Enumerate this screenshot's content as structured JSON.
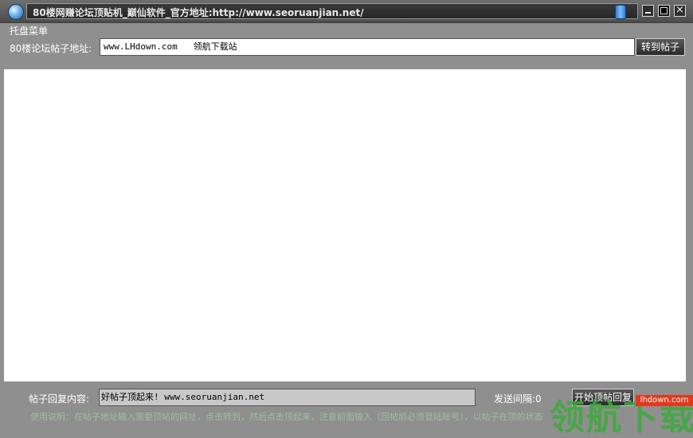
{
  "window": {
    "title": "80楼网赚论坛顶贴机_巅仙软件_官方地址:http://www.seoruanjian.net/",
    "close_glyph": "×"
  },
  "menu": {
    "tray_menu_label": "托盘菜单"
  },
  "url_section": {
    "label": "80楼论坛帖子地址:",
    "value": "www.LHdown.com   领航下载站",
    "goto_button_label": "转到帖子"
  },
  "reply_section": {
    "label": "帖子回复内容:",
    "value": "好帖子顶起来! www.seoruanjian.net",
    "interval_label": "发送间隔:0",
    "start_button_label": "开始顶帖回复"
  },
  "instructions": "使用说明：在帖子地址输入需要顶帖的网址，点击转到，然后点击顶起来，注意前面输入（回帖前必须登陆账号），以帖子在顶的状态",
  "watermark": {
    "badge_text": "lhdown.com",
    "text": "领航下载"
  }
}
